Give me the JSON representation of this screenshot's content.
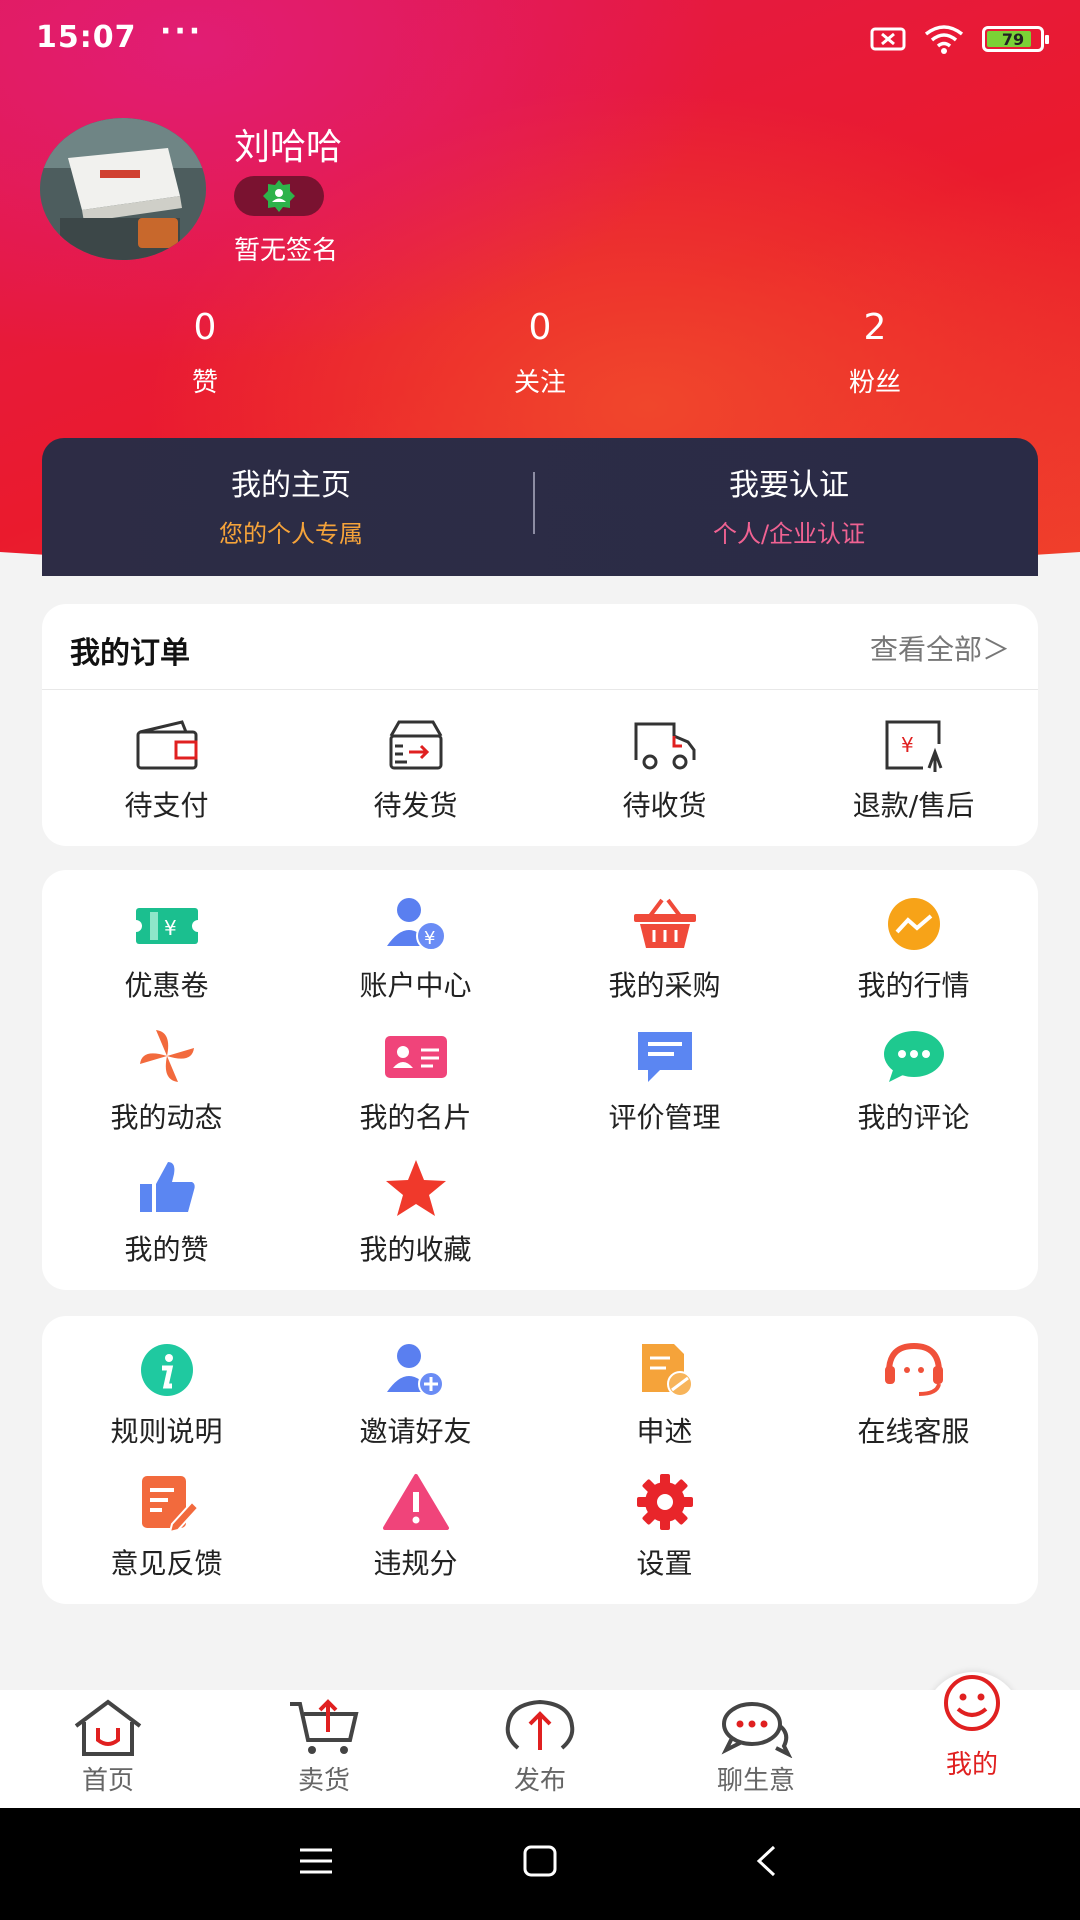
{
  "status": {
    "time": "15:07",
    "dots": "···",
    "battery": "79"
  },
  "profile": {
    "name": "刘哈哈",
    "signature": "暂无签名"
  },
  "stats": [
    {
      "value": "0",
      "label": "赞"
    },
    {
      "value": "0",
      "label": "关注"
    },
    {
      "value": "2",
      "label": "粉丝"
    }
  ],
  "home_card": {
    "home_title": "我的主页",
    "home_sub": "您的个人专属",
    "cert_title": "我要认证",
    "cert_sub": "个人/企业认证"
  },
  "orders": {
    "title": "我的订单",
    "view_all": "查看全部＞",
    "items": [
      {
        "label": "待支付",
        "icon": "wallet-icon"
      },
      {
        "label": "待发货",
        "icon": "ship-box-icon"
      },
      {
        "label": "待收货",
        "icon": "truck-icon"
      },
      {
        "label": "退款/售后",
        "icon": "refund-icon"
      }
    ]
  },
  "features": [
    {
      "label": "优惠卷",
      "icon": "coupon-icon"
    },
    {
      "label": "账户中心",
      "icon": "account-icon"
    },
    {
      "label": "我的采购",
      "icon": "basket-icon"
    },
    {
      "label": "我的行情",
      "icon": "trend-icon"
    },
    {
      "label": "我的动态",
      "icon": "pinwheel-icon"
    },
    {
      "label": "我的名片",
      "icon": "card-icon"
    },
    {
      "label": "评价管理",
      "icon": "review-icon"
    },
    {
      "label": "我的评论",
      "icon": "comment-icon"
    },
    {
      "label": "我的赞",
      "icon": "thumb-icon"
    },
    {
      "label": "我的收藏",
      "icon": "star-icon"
    }
  ],
  "services": [
    {
      "label": "规则说明",
      "icon": "info-icon"
    },
    {
      "label": "邀请好友",
      "icon": "invite-icon"
    },
    {
      "label": "申述",
      "icon": "appeal-icon"
    },
    {
      "label": "在线客服",
      "icon": "headset-icon"
    },
    {
      "label": "意见反馈",
      "icon": "feedback-icon"
    },
    {
      "label": "违规分",
      "icon": "warning-icon"
    },
    {
      "label": "设置",
      "icon": "settings-icon"
    }
  ],
  "tabs": [
    {
      "label": "首页",
      "icon": "home-icon"
    },
    {
      "label": "卖货",
      "icon": "cart-icon"
    },
    {
      "label": "发布",
      "icon": "publish-icon"
    },
    {
      "label": "聊生意",
      "icon": "chat-icon"
    },
    {
      "label": "我的",
      "icon": "smile-icon",
      "active": true
    }
  ],
  "colors": {
    "accent_red": "#e8192c",
    "dark_card": "#2d2c45",
    "home_sub": "#f5a33a",
    "cert_sub": "#f06292",
    "active_tab": "#e02020"
  }
}
